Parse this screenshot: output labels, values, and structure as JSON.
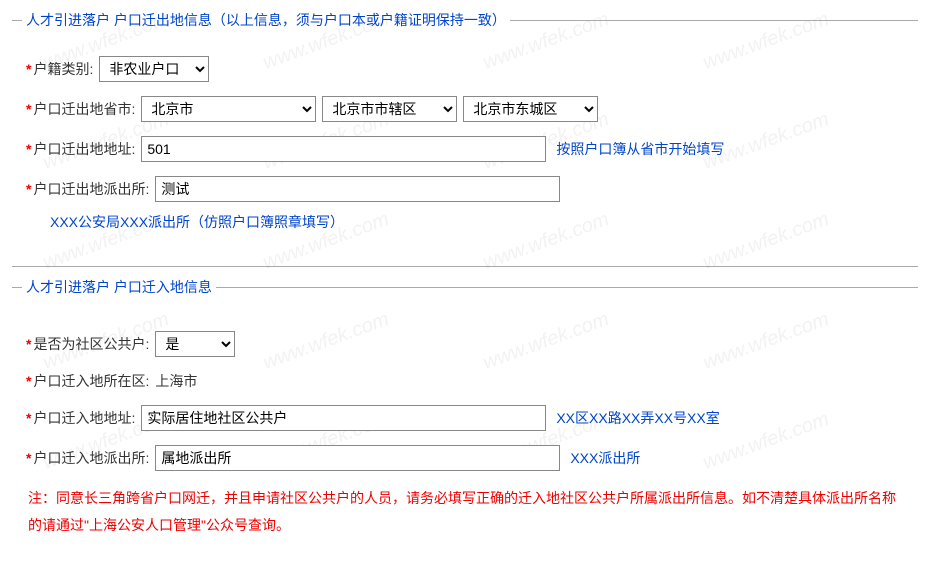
{
  "section1": {
    "legend_prefix": "人才引进落户",
    "legend_main": "户口迁出地信息（以上信息，须与户口本或户籍证明保持一致）",
    "hukou_type_label": "户籍类别:",
    "hukou_type_value": "非农业户口",
    "out_province_label": "户口迁出地省市:",
    "province_value": "北京市",
    "city_value": "北京市市辖区",
    "district_value": "北京市东城区",
    "out_addr_label": "户口迁出地地址:",
    "out_addr_value": "501",
    "out_addr_hint": "按照户口簿从省市开始填写",
    "out_station_label": "户口迁出地派出所:",
    "out_station_value": "测试",
    "out_station_helper": "XXX公安局XXX派出所（仿照户口簿照章填写）"
  },
  "section2": {
    "legend_prefix": "人才引进落户",
    "legend_main": "户口迁入地信息",
    "community_label": "是否为社区公共户:",
    "community_value": "是",
    "in_district_label": "户口迁入地所在区:",
    "in_district_value": "上海市",
    "in_addr_label": "户口迁入地地址:",
    "in_addr_value": "实际居住地社区公共户",
    "in_addr_hint": "XX区XX路XX弄XX号XX室",
    "in_station_label": "户口迁入地派出所:",
    "in_station_value": "属地派出所",
    "in_station_hint": "XXX派出所",
    "warning": "注：同意长三角跨省户口网迁，并且申请社区公共户的人员，请务必填写正确的迁入地社区公共户所属派出所信息。如不清楚具体派出所名称的请通过\"上海公安人口管理\"公众号查询。"
  },
  "watermark_text": "www.wfek.com"
}
